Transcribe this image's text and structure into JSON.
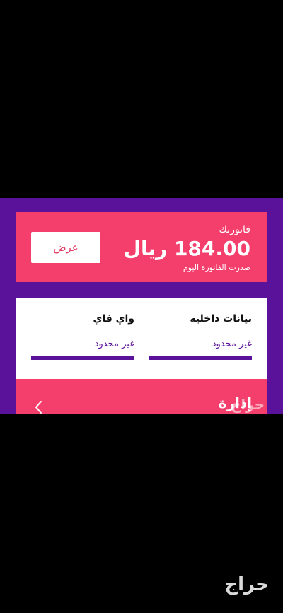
{
  "bill": {
    "title": "فاتورتك",
    "amount": "184.00 ريال",
    "subtitle": "صدرت الفاتورة اليوم",
    "view_button": "عرض"
  },
  "usage": {
    "items": [
      {
        "label": "بيانات داخلية",
        "value": "غير محدود",
        "progress_percent": 100
      },
      {
        "label": "واي فاي",
        "value": "غير محدود",
        "progress_percent": 100
      }
    ]
  },
  "manage": {
    "title": "إدارة"
  },
  "watermark": {
    "text": "حراج"
  },
  "colors": {
    "background": "#000000",
    "primary_purple": "#5a129a",
    "accent_pink": "#f43f6c",
    "card_white": "#ffffff"
  },
  "icons": {
    "manage_chevron": "chevron-left-icon"
  }
}
